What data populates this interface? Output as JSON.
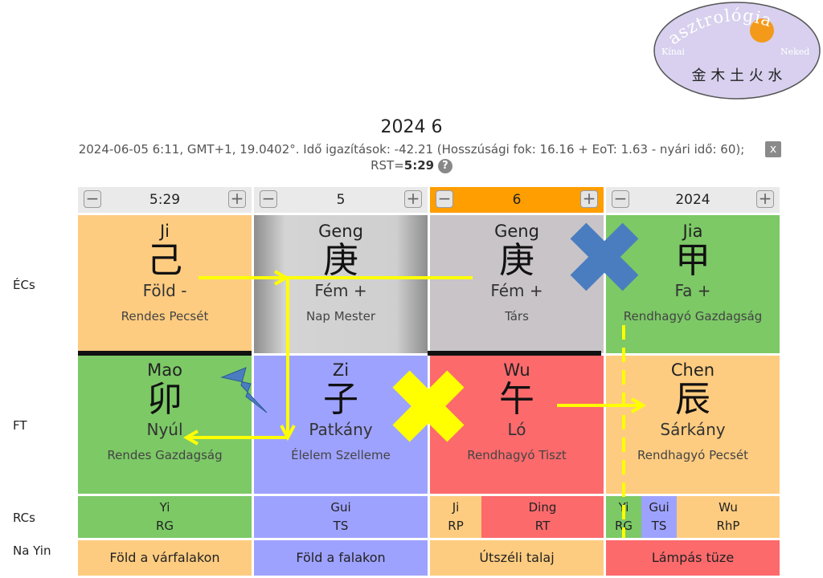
{
  "logo": {
    "arc_text": "asztrológia",
    "left_text": "Kínai",
    "right_text": "Neked",
    "chars": "金 木 土 火 水",
    "colors": {
      "disc": "#d8d0ee",
      "sun": "#f39a1a"
    }
  },
  "header": {
    "title": "2024 6",
    "info": "2024-06-05 6:11, GMT+1, 19.0402°. Idő igazítások: -42.21 (Hosszúsági fok: 16.16 + EoT: 1.63 - nyári idő: 60); RST=",
    "rst": "5:29",
    "help_icon": "?",
    "close_label": "x"
  },
  "columns": [
    {
      "value": "5:29",
      "active": false
    },
    {
      "value": "5",
      "active": false
    },
    {
      "value": "6",
      "active": true
    },
    {
      "value": "2024",
      "active": false
    }
  ],
  "row_labels": {
    "stems": "ÉCs",
    "branches": "FT",
    "roots": "RCs",
    "nayin": "Na Yin"
  },
  "stems": [
    {
      "pinyin": "Ji",
      "hanzi": "己",
      "element": "Föld -",
      "god": "Rendes Pecsét",
      "color": "#fecc80"
    },
    {
      "pinyin": "Geng",
      "hanzi": "庚",
      "element": "Fém +",
      "god": "Nap Mester",
      "color": "#c8c4c8"
    },
    {
      "pinyin": "Geng",
      "hanzi": "庚",
      "element": "Fém +",
      "god": "Társ",
      "color": "#c8c4c8"
    },
    {
      "pinyin": "Jia",
      "hanzi": "甲",
      "element": "Fa +",
      "god": "Rendhagyó Gazdagság",
      "color": "#7cc966"
    }
  ],
  "branches": [
    {
      "pinyin": "Mao",
      "hanzi": "卯",
      "animal": "Nyúl",
      "god": "Rendes Gazdagság",
      "color": "#7cc966"
    },
    {
      "pinyin": "Zi",
      "hanzi": "子",
      "animal": "Patkány",
      "god": "Élelem Szelleme",
      "color": "#9ea2ff"
    },
    {
      "pinyin": "Wu",
      "hanzi": "午",
      "animal": "Ló",
      "god": "Rendhagyó Tiszt",
      "color": "#fc6a6c"
    },
    {
      "pinyin": "Chen",
      "hanzi": "辰",
      "animal": "Sárkány",
      "god": "Rendhagyó Pecsét",
      "color": "#fecc80"
    }
  ],
  "roots": [
    [
      {
        "stem": "Yi",
        "god": "RG"
      }
    ],
    [
      {
        "stem": "Gui",
        "god": "TS"
      }
    ],
    [
      {
        "stem": "Ji",
        "god": "RP"
      },
      {
        "stem": "Ding",
        "god": "RT"
      }
    ],
    [
      {
        "stem": "Yi",
        "god": "RG"
      },
      {
        "stem": "Gui",
        "god": "TS"
      },
      {
        "stem": "Wu",
        "god": "RhP"
      }
    ]
  ],
  "nayin": [
    {
      "label": "Föld a várfalakon",
      "color": "#fecc80"
    },
    {
      "label": "Föld a falakon",
      "color": "#9ea2ff"
    },
    {
      "label": "Útszéli talaj",
      "color": "#fecc80"
    },
    {
      "label": "Lámpás tüze",
      "color": "#fc6a6c"
    }
  ],
  "markers": {
    "clash_x_color": "#ffff00",
    "combine_x_color": "#4a7dbf",
    "arrow_color": "#ffff00",
    "lightning_color": "#4a7dbf"
  }
}
